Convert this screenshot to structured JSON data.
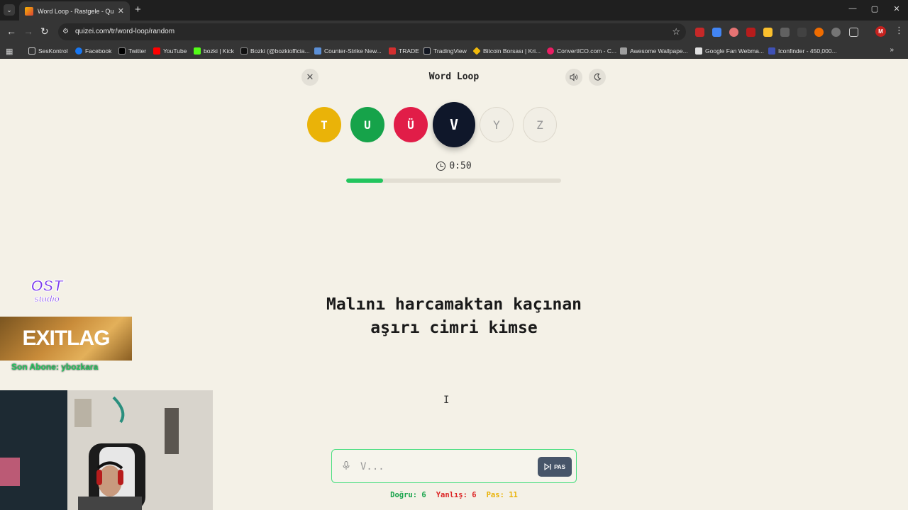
{
  "browser": {
    "tab_title": "Word Loop - Rastgele - Quizei",
    "url": "quizei.com/tr/word-loop/random",
    "profile_initial": "M",
    "bookmarks": [
      "SesKontrol",
      "Facebook",
      "Twitter",
      "YouTube",
      "bozki | Kick",
      "Bozki (@bozkiofficia...",
      "Counter-Strike New...",
      "TRADE",
      "TradingView",
      "Bitcoin Borsası | Kri...",
      "ConvertICO.com - C...",
      "Awesome Wallpape...",
      "Google Fan Webma...",
      "Iconfinder - 450,000..."
    ]
  },
  "game": {
    "title": "Word Loop",
    "letters": [
      {
        "char": "T",
        "state": "yellow"
      },
      {
        "char": "U",
        "state": "green"
      },
      {
        "char": "Ü",
        "state": "red"
      },
      {
        "char": "V",
        "state": "active"
      },
      {
        "char": "Y",
        "state": "pending"
      },
      {
        "char": "Z",
        "state": "pending"
      }
    ],
    "timer": "0:50",
    "progress_fraction": 0.17,
    "clue_line1": "Malını harcamaktan kaçınan",
    "clue_line2": "aşırı cimri kimse",
    "input_placeholder": "V...",
    "pass_label": "PAS",
    "stats": {
      "correct": "Doğru: 6",
      "wrong": "Yanlış: 6",
      "pass": "Pas: 11"
    }
  },
  "overlay": {
    "logo_line1": "OST",
    "logo_line2": "studio",
    "sponsor": "EXITLAG",
    "last_sub": "Son Abone: ybozkara"
  },
  "colors": {
    "correct": "#16a34a",
    "wrong": "#dc2626",
    "pass": "#eab308",
    "active_letter": "#0f172a",
    "progress": "#22c55e"
  }
}
